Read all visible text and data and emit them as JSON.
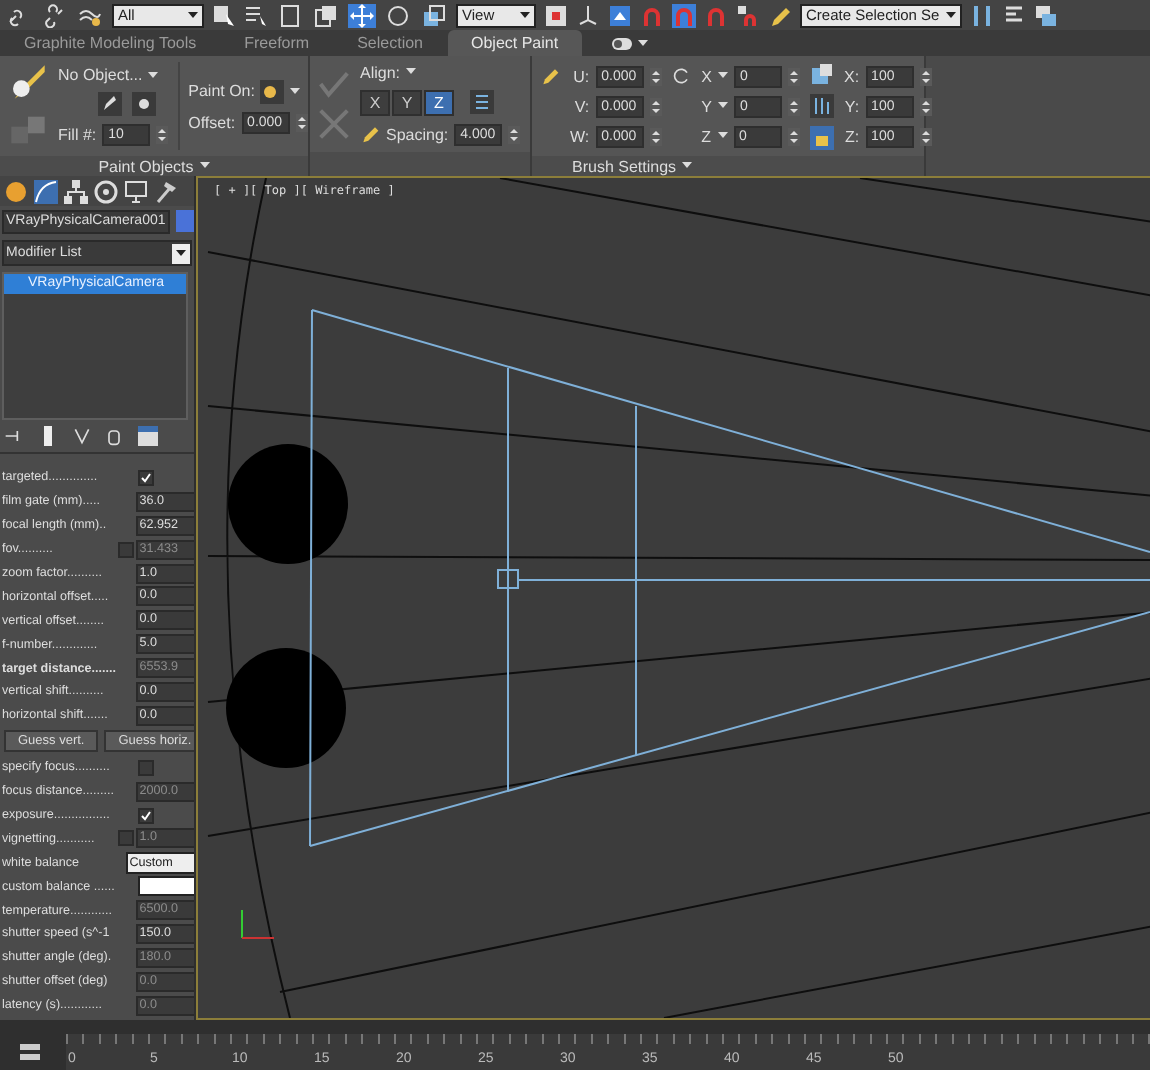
{
  "toolbar": {
    "dropdowns": [
      {
        "value": "All"
      },
      {
        "value": "View"
      },
      {
        "value": "Create Selection Se"
      }
    ]
  },
  "ribbon_tabs": [
    {
      "label": "Graphite Modeling Tools",
      "selected": false
    },
    {
      "label": "Freeform",
      "selected": false
    },
    {
      "label": "Selection",
      "selected": false
    },
    {
      "label": "Object Paint",
      "selected": true
    }
  ],
  "paint_objects": {
    "object": "No Object...",
    "paint_on_label": "Paint On:",
    "offset_label": "Offset:",
    "offset_value": "0.000",
    "fill_label": "Fill #:",
    "fill_value": "10",
    "footer": "Paint Objects"
  },
  "align_group": {
    "align_label": "Align:",
    "axes": [
      {
        "label": "X",
        "selected": false
      },
      {
        "label": "Y",
        "selected": false
      },
      {
        "label": "Z",
        "selected": true
      }
    ],
    "spacing_label": "Spacing:",
    "spacing_value": "4.000"
  },
  "brush_settings": {
    "scale_fields": [
      {
        "label": "U:",
        "value": "0.000"
      },
      {
        "label": "V:",
        "value": "0.000"
      },
      {
        "label": "W:",
        "value": "0.000"
      }
    ],
    "rotate_fields": [
      {
        "label": "X",
        "value": "0"
      },
      {
        "label": "Y",
        "value": "0"
      },
      {
        "label": "Z",
        "value": "0"
      }
    ],
    "size_fields": [
      {
        "label": "X:",
        "value": "100"
      },
      {
        "label": "Y:",
        "value": "100"
      },
      {
        "label": "Z:",
        "value": "100"
      }
    ],
    "footer": "Brush Settings"
  },
  "command_panel": {
    "object_name": "VRayPhysicalCamera001",
    "modifier_list": "Modifier List",
    "stack": [
      {
        "label": "VRayPhysicalCamera",
        "selected": true
      }
    ],
    "params": [
      {
        "kind": "check",
        "label": "targeted..............",
        "checked": true
      },
      {
        "kind": "spinner",
        "label": "film gate (mm).....",
        "value": "36.0",
        "disabled": false
      },
      {
        "kind": "spinner",
        "label": "focal length (mm)..",
        "value": "62.952",
        "disabled": false
      },
      {
        "kind": "check_spinner",
        "label": "fov..........",
        "checked": false,
        "value": "31.433",
        "disabled": true
      },
      {
        "kind": "spinner",
        "label": "zoom factor..........",
        "value": "1.0",
        "disabled": false
      },
      {
        "kind": "spinner",
        "label": "horizontal offset.....",
        "value": "0.0",
        "disabled": false
      },
      {
        "kind": "spinner",
        "label": "vertical offset........",
        "value": "0.0",
        "disabled": false
      },
      {
        "kind": "spinner",
        "label": "f-number.............",
        "value": "5.0",
        "disabled": false
      },
      {
        "kind": "spinner",
        "label": "target distance.......",
        "value": "6553.9",
        "disabled": true,
        "bold": true
      },
      {
        "kind": "spinner",
        "label": "vertical shift..........",
        "value": "0.0",
        "disabled": false
      },
      {
        "kind": "spinner",
        "label": "horizontal shift.......",
        "value": "0.0",
        "disabled": false
      },
      {
        "kind": "buttons",
        "labels": [
          "Guess vert.",
          "Guess horiz."
        ]
      },
      {
        "kind": "check",
        "label": "specify focus..........",
        "checked": false
      },
      {
        "kind": "spinner",
        "label": "focus distance.........",
        "value": "2000.0",
        "disabled": true
      },
      {
        "kind": "check",
        "label": "exposure................",
        "checked": true
      },
      {
        "kind": "check_spinner",
        "label": "vignetting...........",
        "checked": false,
        "value": "1.0",
        "disabled": true
      },
      {
        "kind": "dropdown",
        "label": "white balance",
        "value": "Custom"
      },
      {
        "kind": "swatch",
        "label": "custom balance ......",
        "color": "#ffffff"
      },
      {
        "kind": "spinner",
        "label": "temperature............",
        "value": "6500.0",
        "disabled": true
      },
      {
        "kind": "spinner",
        "label": "shutter speed (s^-1",
        "value": "150.0",
        "disabled": false
      },
      {
        "kind": "spinner",
        "label": "shutter angle (deg).",
        "value": "180.0",
        "disabled": true
      },
      {
        "kind": "spinner",
        "label": "shutter offset (deg)",
        "value": "0.0",
        "disabled": true
      },
      {
        "kind": "spinner",
        "label": "latency (s)............",
        "value": "0.0",
        "disabled": true
      }
    ]
  },
  "viewport": {
    "label": "[ + ][ Top ][ Wireframe ]"
  },
  "timeline": {
    "ticks": [
      "0",
      "5",
      "10",
      "15",
      "20",
      "25",
      "30",
      "35",
      "40",
      "45",
      "50"
    ]
  }
}
